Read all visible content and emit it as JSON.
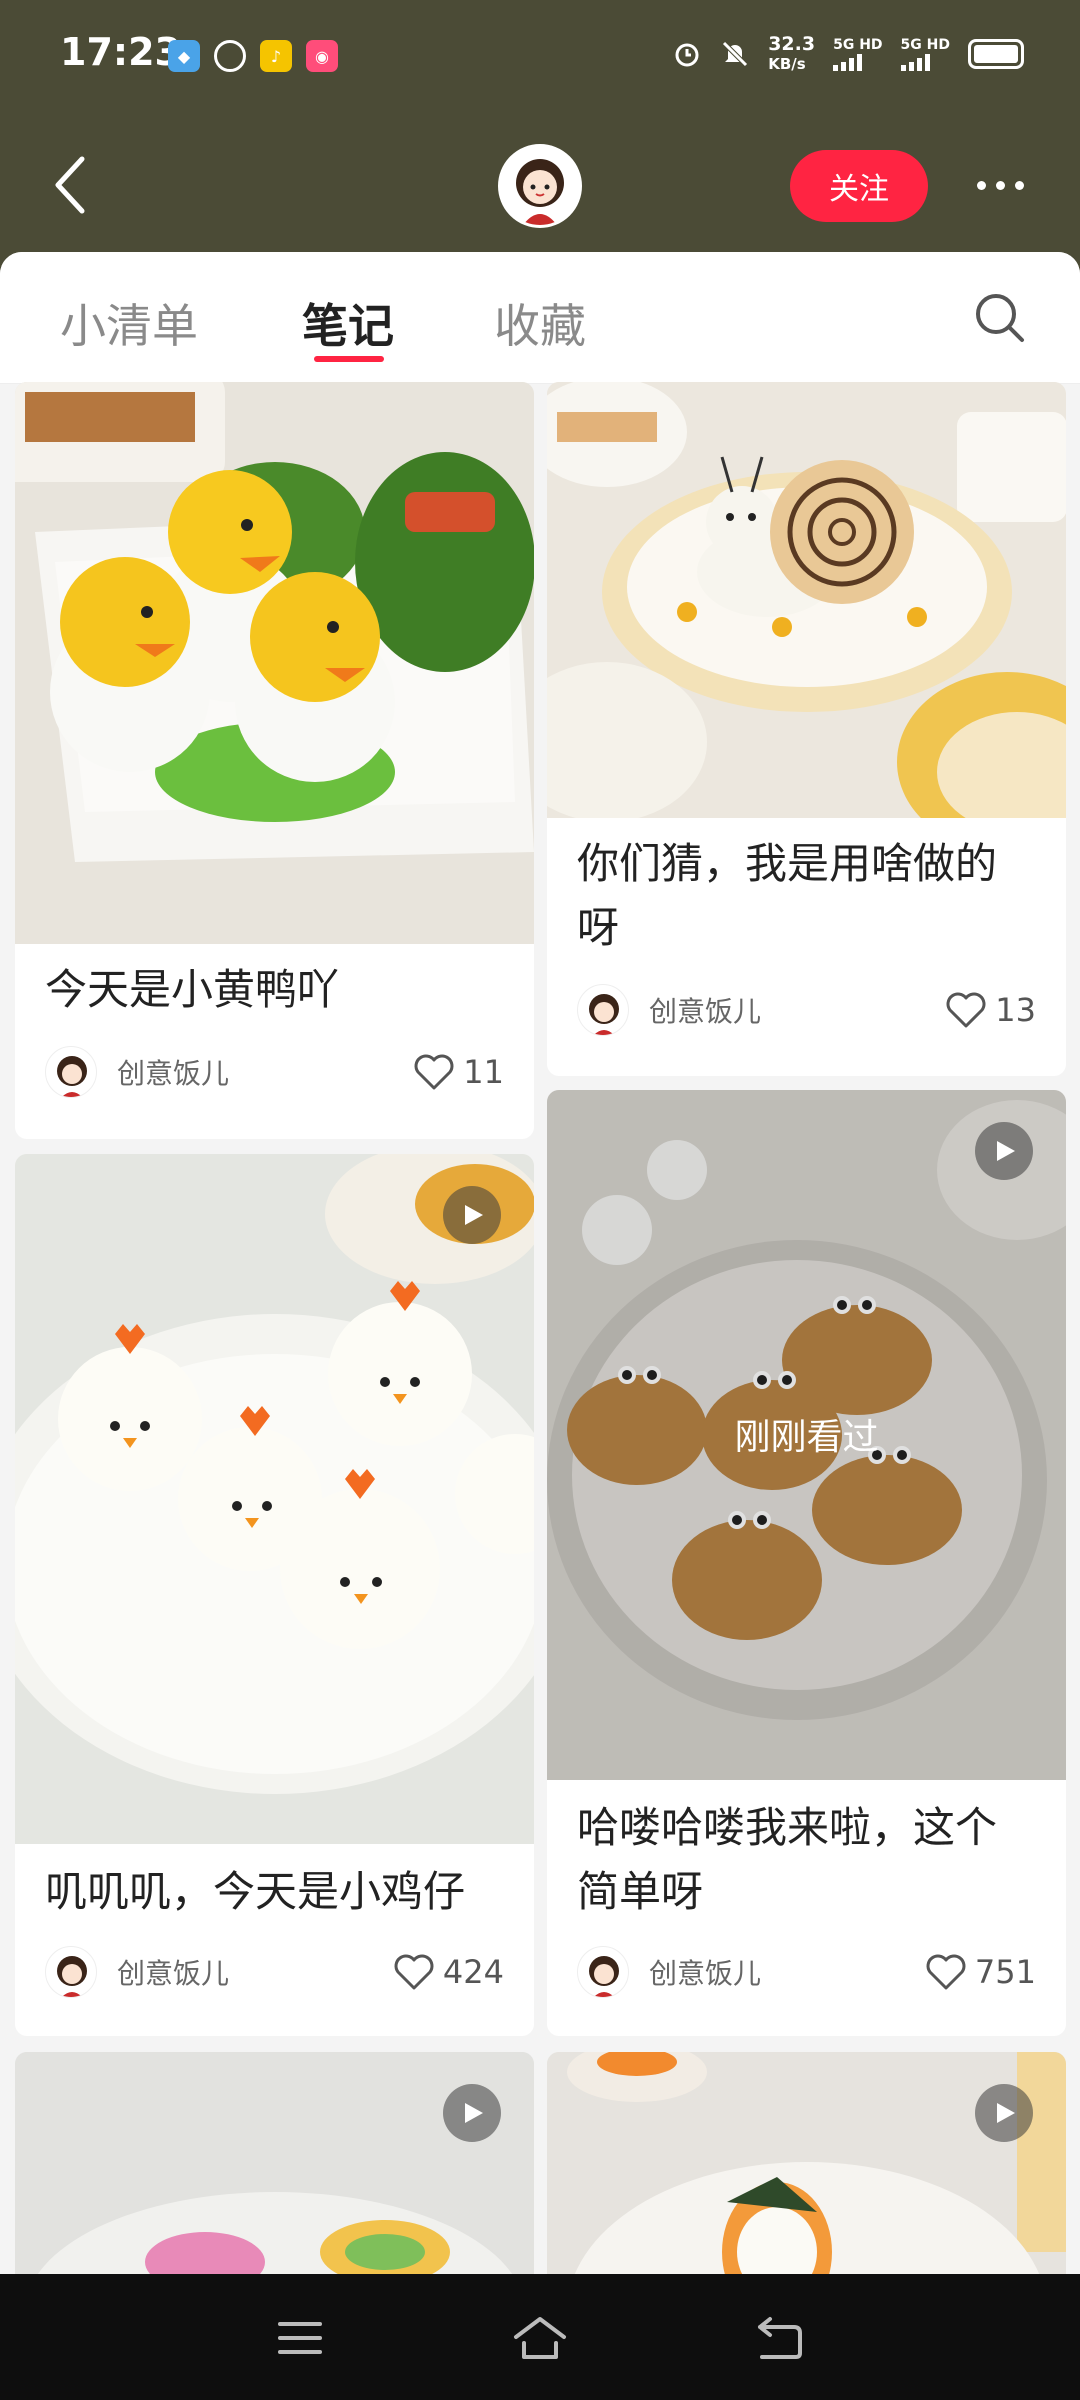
{
  "status_bar": {
    "time": "17:23",
    "net_speed_value": "32.3",
    "net_speed_unit": "KB/s",
    "sim1": "5G HD",
    "sim2": "5G HD",
    "icons": [
      "alarm-icon",
      "mute-icon",
      "battery-icon"
    ]
  },
  "header": {
    "back_icon": "chevron-left-icon",
    "follow_label": "关注",
    "more_icon": "more-dots-icon"
  },
  "tabs": [
    {
      "label": "小清单",
      "active": false
    },
    {
      "label": "笔记",
      "active": true
    },
    {
      "label": "收藏",
      "active": false
    }
  ],
  "accent_color": "#ff2442",
  "cards": [
    {
      "title": "今天是小黄鸭吖",
      "author": "创意饭儿",
      "likes": "11",
      "video": false
    },
    {
      "title": "你们猜，我是用啥做的呀",
      "author": "创意饭儿",
      "likes": "13",
      "video": false
    },
    {
      "title": "叽叽叽，今天是小鸡仔",
      "author": "创意饭儿",
      "likes": "424",
      "video": true
    },
    {
      "title": "哈喽哈喽我来啦，这个简单呀",
      "author": "创意饭儿",
      "likes": "751",
      "video": true,
      "overlay": "刚刚看过"
    },
    {
      "title": "",
      "author": "",
      "likes": "",
      "video": true
    },
    {
      "title": "",
      "author": "",
      "likes": "",
      "video": true
    }
  ]
}
